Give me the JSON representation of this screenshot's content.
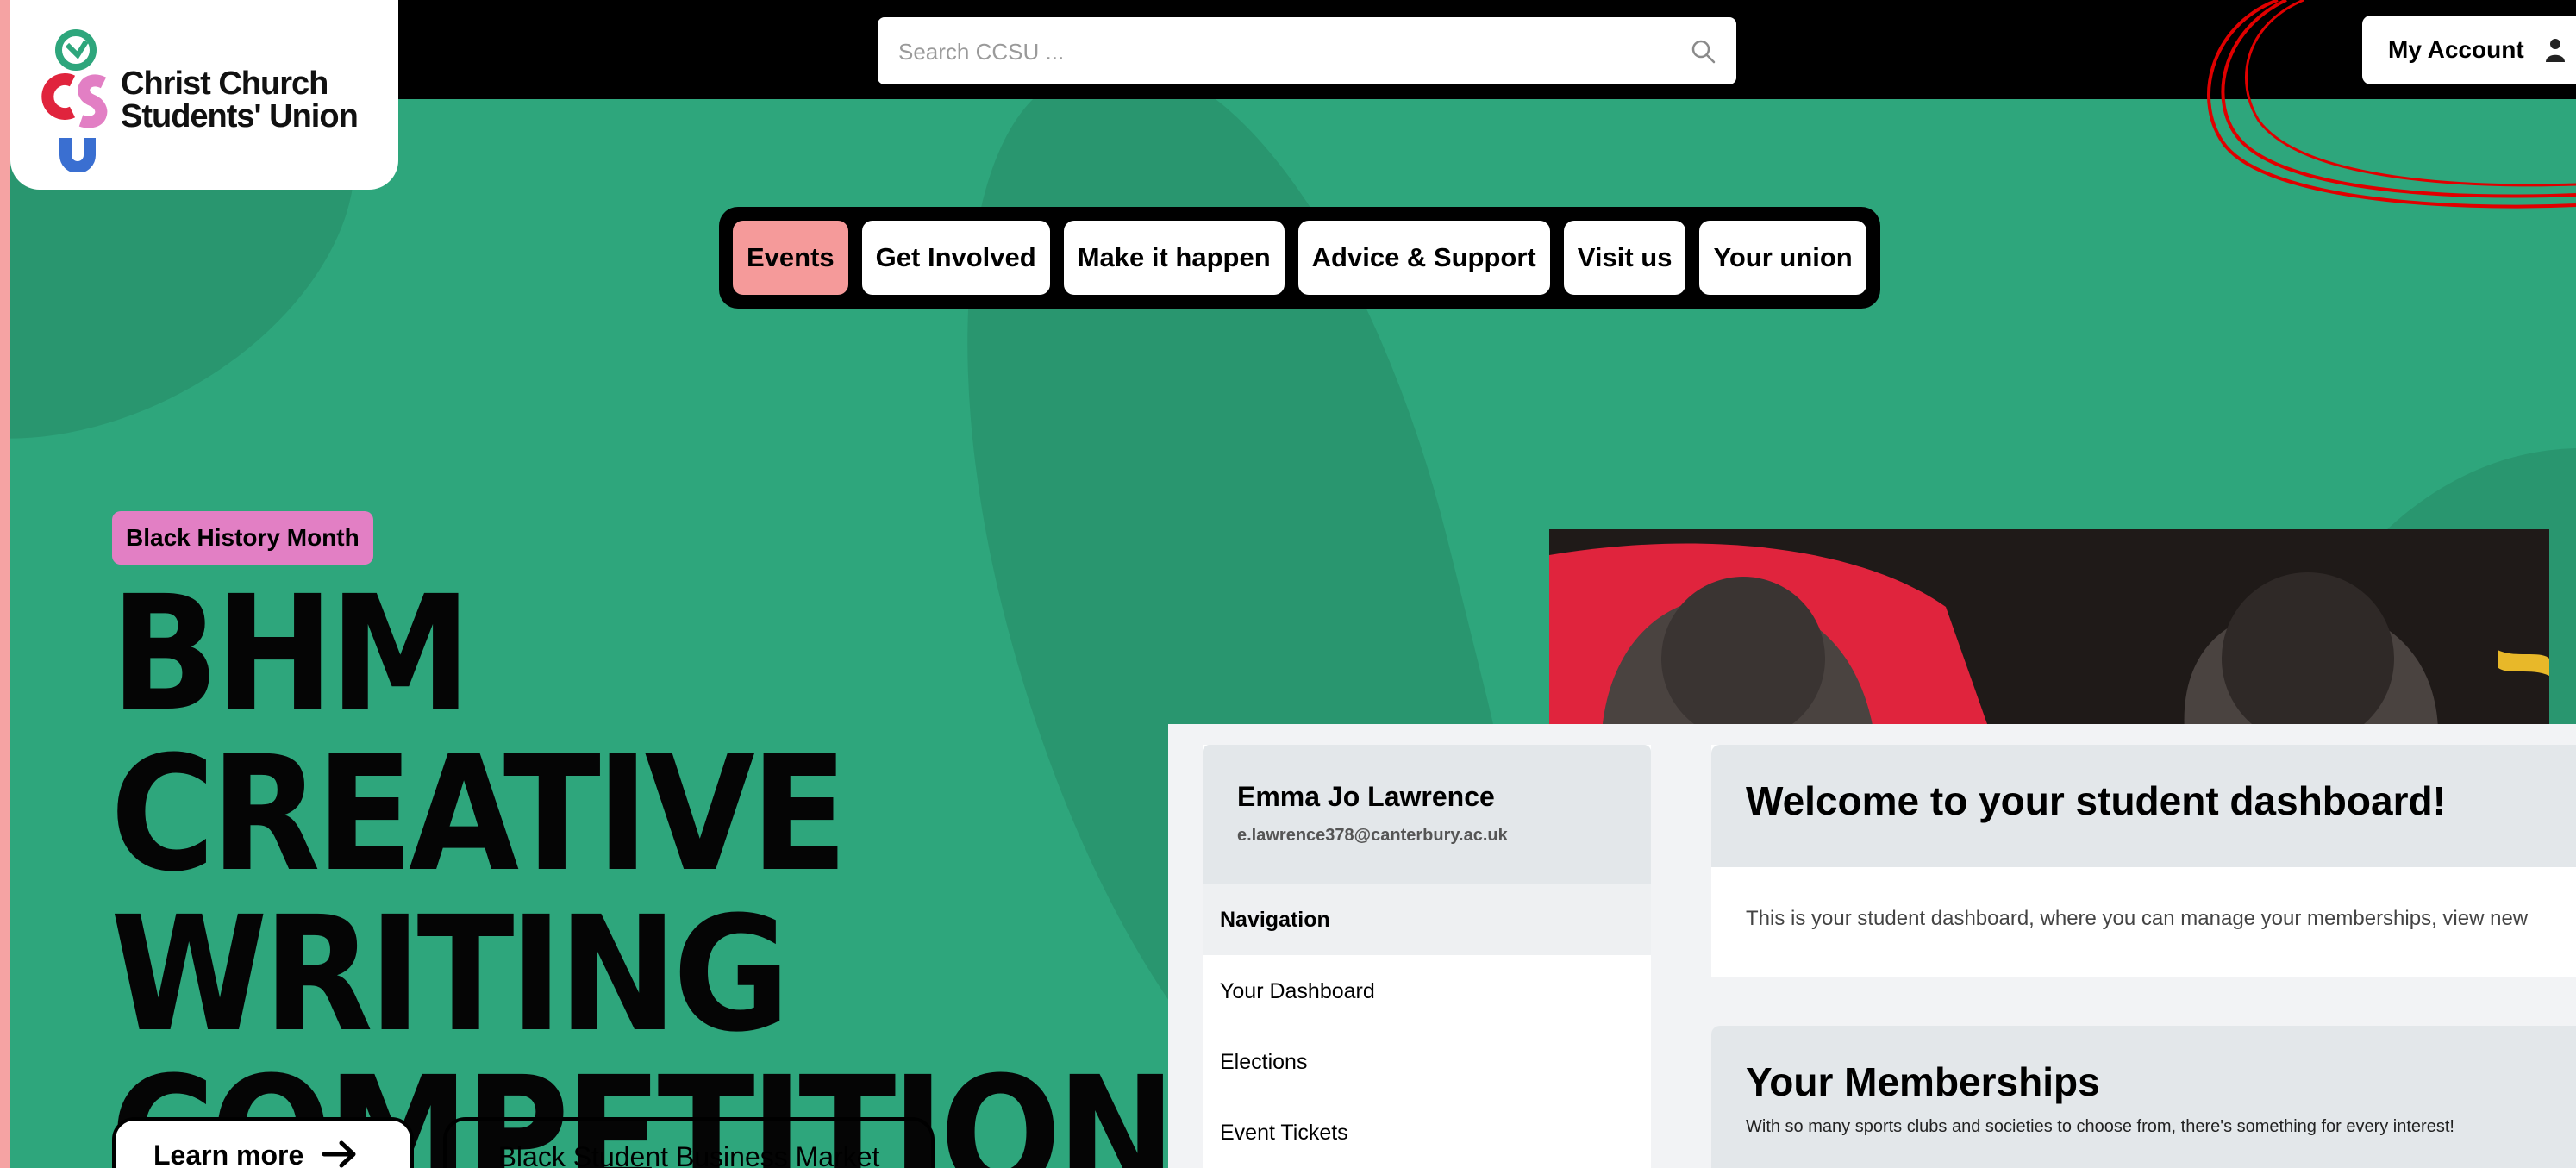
{
  "brand": {
    "logo_line1": "Christ Church",
    "logo_line2": "Students' Union"
  },
  "search": {
    "placeholder": "Search CCSU ..."
  },
  "account": {
    "label": "My Account"
  },
  "nav": {
    "items": [
      "Events",
      "Get Involved",
      "Make it happen",
      "Advice & Support",
      "Visit us",
      "Your union"
    ],
    "active": "Events"
  },
  "hero": {
    "tag": "Black History Month",
    "title_lines": [
      "BHM CREATIVE",
      "WRITING",
      "COMPETITION"
    ],
    "learn_more": "Learn more",
    "secondary_button": "Black Student Business Market"
  },
  "dashboard": {
    "user_name": "Emma Jo Lawrence",
    "user_email": "e.lawrence378@canterbury.ac.uk",
    "nav_heading": "Navigation",
    "nav_items": [
      "Your Dashboard",
      "Elections",
      "Event Tickets"
    ],
    "welcome_title": "Welcome to your student dashboard!",
    "welcome_text": "This is your student dashboard, where you can manage your memberships, view new",
    "memberships_title": "Your Memberships",
    "memberships_text": "With so many sports clubs and societies to choose from, there's something for every interest!"
  },
  "colors": {
    "background": "#2ea67c",
    "topbar": "#000000",
    "active_pill": "#f59a9a",
    "tag": "#e27fc4",
    "annotation": "#e00000",
    "frame": "#f5a3a3"
  },
  "icons": [
    "search-icon",
    "user-icon",
    "arrow-right-icon"
  ]
}
